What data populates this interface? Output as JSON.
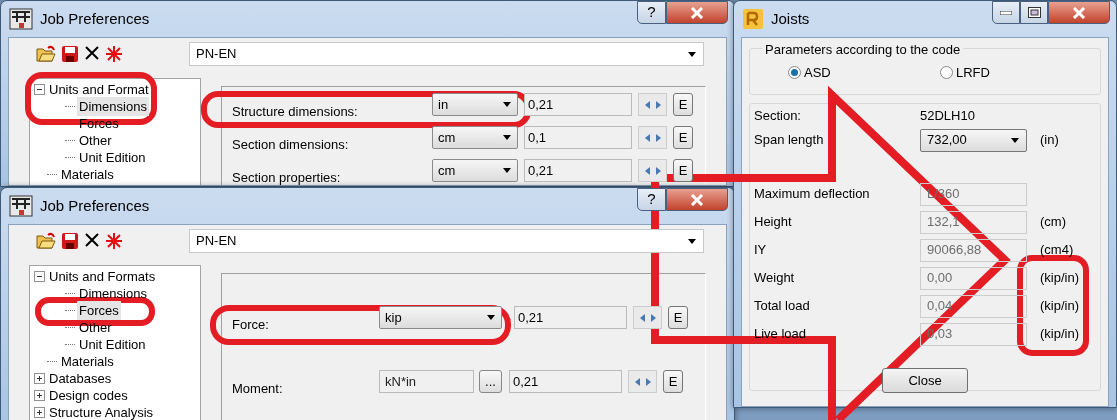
{
  "windows": [
    {
      "title": "Job Preferences",
      "help": "?",
      "code": "PN-EN",
      "tree": [
        {
          "label": "Units and Format",
          "expanded": true,
          "selected": false,
          "children": [
            {
              "label": "Dimensions",
              "selected": true
            },
            {
              "label": "Forces",
              "selected": false
            },
            {
              "label": "Other",
              "selected": false
            },
            {
              "label": "Unit Edition",
              "selected": false
            }
          ]
        },
        {
          "label": "Materials",
          "selected": false
        }
      ],
      "fields": [
        {
          "kind": "combo",
          "label": "Structure dimensions:",
          "unit": "in",
          "value": "0,21",
          "edit": "E"
        },
        {
          "kind": "combo",
          "label": "Section dimensions:",
          "unit": "cm",
          "value": "0,1",
          "edit": "E"
        },
        {
          "kind": "combo",
          "label": "Section properties:",
          "unit": "cm",
          "value": "0,21",
          "edit": "E"
        }
      ]
    },
    {
      "title": "Job Preferences",
      "help": "?",
      "code": "PN-EN",
      "tree": [
        {
          "label": "Units and Formats",
          "expanded": true,
          "selected": false,
          "children": [
            {
              "label": "Dimensions",
              "selected": false
            },
            {
              "label": "Forces",
              "selected": true
            },
            {
              "label": "Other",
              "selected": false
            },
            {
              "label": "Unit Edition",
              "selected": false
            }
          ]
        },
        {
          "label": "Materials",
          "selected": false
        },
        {
          "label": "Databases",
          "expanded": false,
          "selected": false
        },
        {
          "label": "Design codes",
          "expanded": false,
          "selected": false
        },
        {
          "label": "Structure Analysis",
          "expanded": false,
          "selected": false
        }
      ],
      "fields": [
        {
          "kind": "combo",
          "label": "Force:",
          "unit": "kip",
          "value": "0,21",
          "edit": "E"
        },
        {
          "kind": "browse",
          "label": "Moment:",
          "unit": "kN*in",
          "browse": "...",
          "value": "0,21",
          "edit": "E"
        }
      ]
    }
  ],
  "joists": {
    "title": "Joists",
    "group": "Parameters according to the code",
    "options": [
      {
        "label": "ASD",
        "selected": true
      },
      {
        "label": "LRFD",
        "selected": false
      }
    ],
    "rows": [
      {
        "kind": "text",
        "label": "Section:",
        "value": "52DLH10"
      },
      {
        "kind": "combo",
        "label": "Span length",
        "value": "732,00",
        "unit": "(in)"
      },
      {
        "kind": "readonly",
        "label": "Maximum deflection",
        "value": "L/360"
      },
      {
        "kind": "readonly",
        "label": "Height",
        "value": "132,1",
        "unit": "(cm)"
      },
      {
        "kind": "readonly",
        "label": "IY",
        "value": "90066,88",
        "unit": "(cm4)"
      },
      {
        "kind": "readonly",
        "label": "Weight",
        "value": "0,00",
        "unit": "(kip/in)"
      },
      {
        "kind": "readonly",
        "label": "Total load",
        "value": "0,04",
        "unit": "(kip/in)"
      },
      {
        "kind": "readonly",
        "label": "Live load",
        "value": "0,03",
        "unit": "(kip/in)"
      }
    ],
    "close": "Close"
  }
}
